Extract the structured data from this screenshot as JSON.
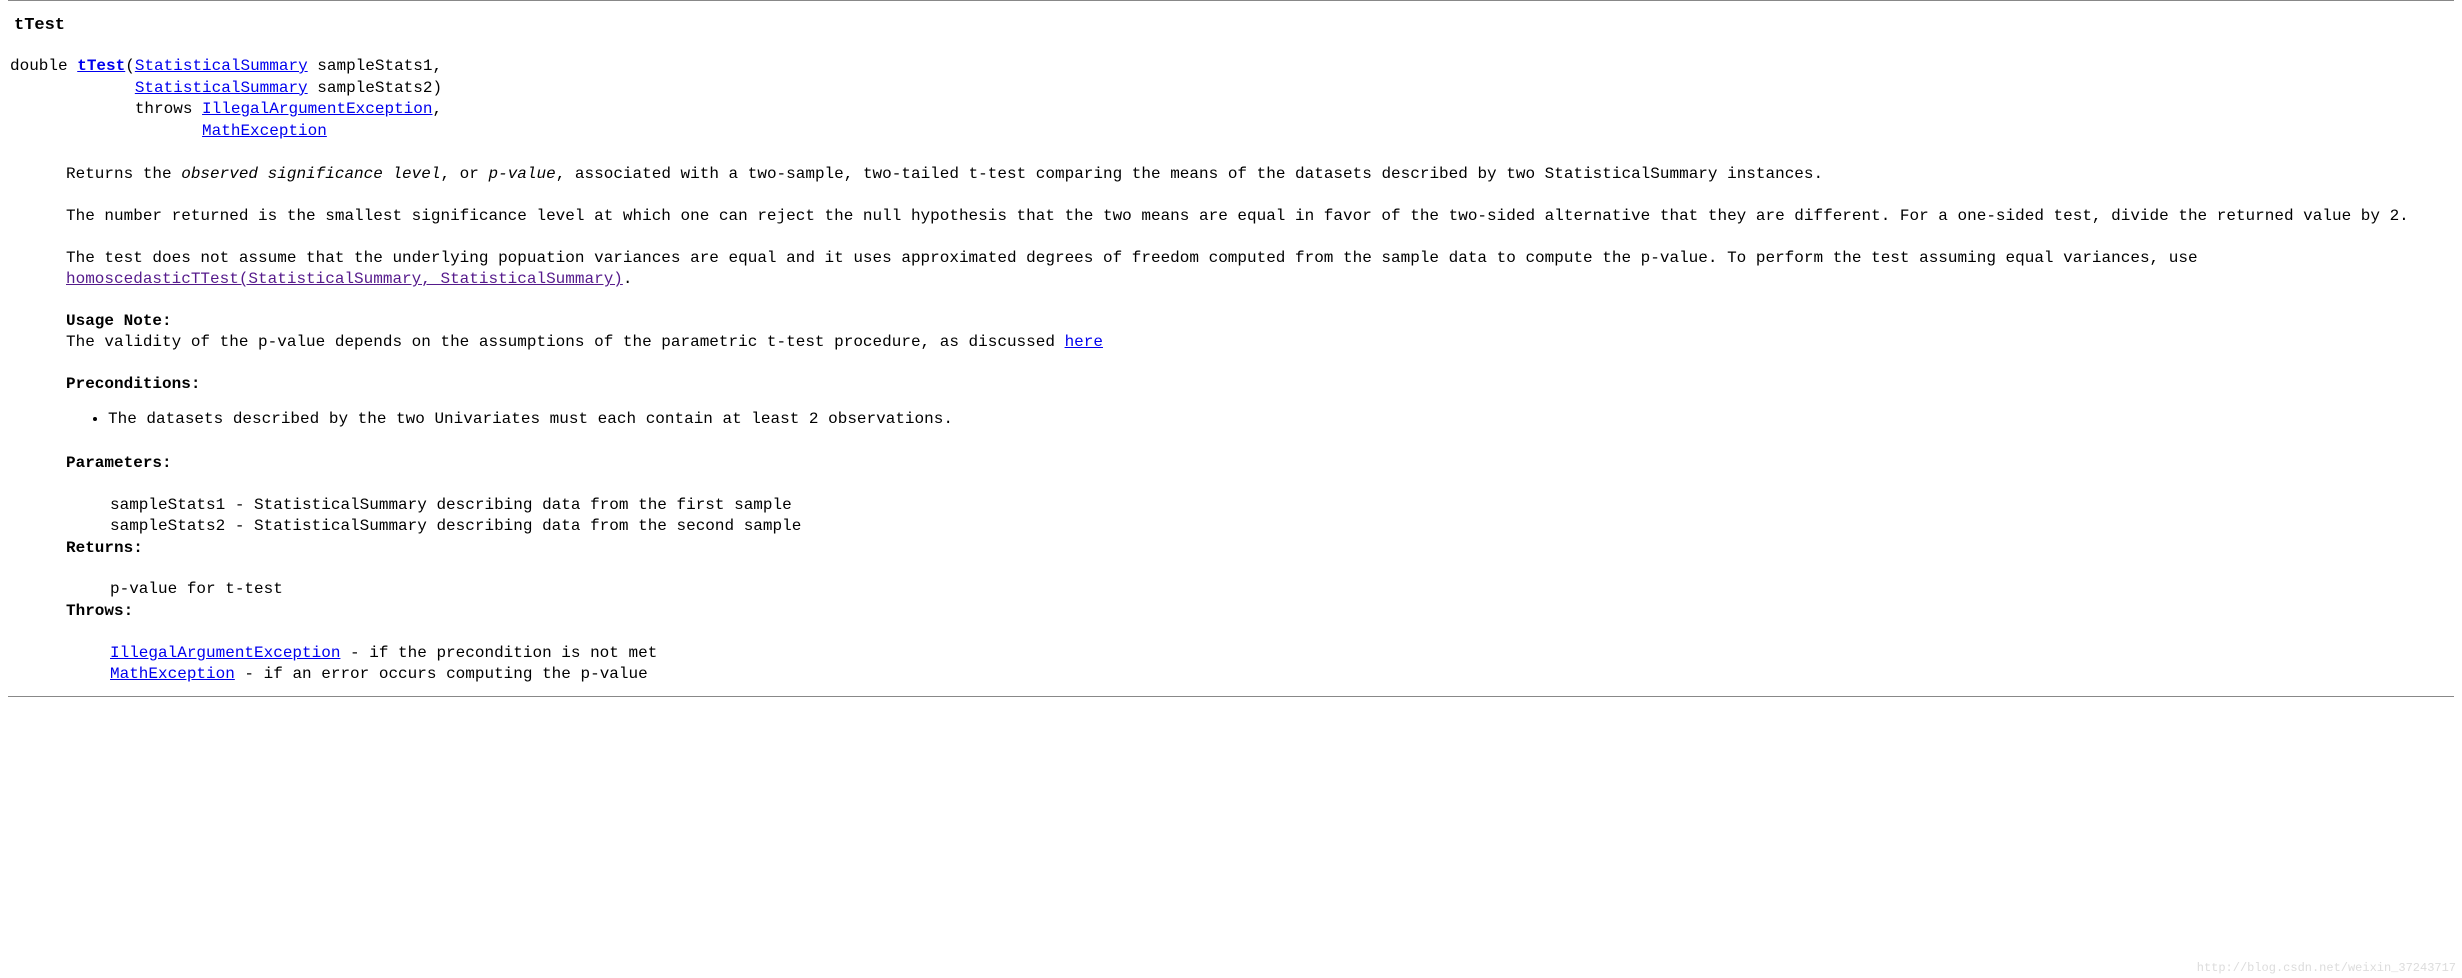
{
  "method": {
    "title": "tTest",
    "signature": {
      "return_type": "double ",
      "name": "tTest",
      "type_link": "StatisticalSummary",
      "param1": " sampleStats1,",
      "param2": " sampleStats2)",
      "throws_kw": "throws ",
      "throws1": "IllegalArgumentException",
      "throws_sep": ",",
      "throws2": "MathException"
    },
    "desc": {
      "p1_a": "Returns the ",
      "p1_em1": "observed significance level",
      "p1_b": ", or ",
      "p1_em2": "p-value",
      "p1_c": ", associated with a two-sample, two-tailed t-test comparing the means of the datasets described by two StatisticalSummary instances.",
      "p2": "The number returned is the smallest significance level at which one can reject the null hypothesis that the two means are equal in favor of the two-sided alternative that they are different. For a one-sided test, divide the returned value by 2.",
      "p3_a": "The test does not assume that the underlying popuation variances are equal and it uses approximated degrees of freedom computed from the sample data to compute the p-value. To perform the test assuming equal variances, use ",
      "p3_link": "homoscedasticTTest(StatisticalSummary, StatisticalSummary)",
      "p3_b": ".",
      "usage_label": "Usage Note:",
      "usage_text_a": "The validity of the p-value depends on the assumptions of the parametric t-test procedure, as discussed ",
      "usage_link": "here",
      "precond_label": "Preconditions:",
      "precond_item": "The datasets described by the two Univariates must each contain at least 2 observations."
    },
    "tags": {
      "parameters_label": "Parameters:",
      "param1": "sampleStats1 - StatisticalSummary describing data from the first sample",
      "param2": "sampleStats2 - StatisticalSummary describing data from the second sample",
      "returns_label": "Returns:",
      "returns_text": "p-value for t-test",
      "throws_label": "Throws:",
      "throws1_link": "IllegalArgumentException",
      "throws1_text": " - if the precondition is not met",
      "throws2_link": "MathException",
      "throws2_text": " - if an error occurs computing the p-value"
    }
  },
  "watermark": "http://blog.csdn.net/weixin_37243717"
}
